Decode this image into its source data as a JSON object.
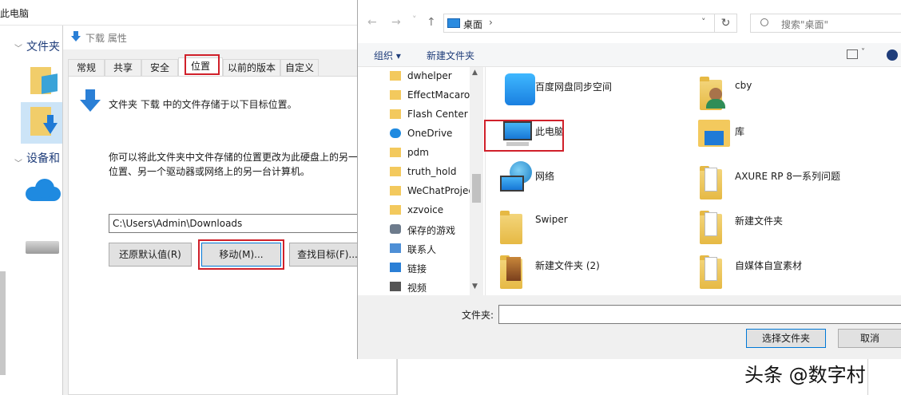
{
  "background_window": {
    "title": "此电脑",
    "nav_sections": [
      "文件夹",
      "设备和"
    ]
  },
  "properties_dialog": {
    "title": "下载 属性",
    "tabs": [
      "常规",
      "共享",
      "安全",
      "位置",
      "以前的版本",
      "自定义"
    ],
    "active_tab": "位置",
    "description": "文件夹 下载 中的文件存储于以下目标位置。",
    "info_line1": "你可以将此文件夹中文件存储的位置更改为此硬盘上的另一",
    "info_line2": "位置、另一个驱动器或网络上的另一台计算机。",
    "path_value": "C:\\Users\\Admin\\Downloads",
    "buttons": {
      "restore": "还原默认值(R)",
      "move": "移动(M)...",
      "find_target": "查找目标(F)..."
    }
  },
  "select_folder_dialog": {
    "nav": {
      "back": "←",
      "forward": "→",
      "up": "↑",
      "dropdown": "˅",
      "refresh": "↻"
    },
    "address": {
      "location": "桌面",
      "separator": "›"
    },
    "search": {
      "placeholder": "搜索\"桌面\""
    },
    "command_bar": {
      "organize": "组织 ▾",
      "new_folder": "新建文件夹"
    },
    "tree_items": [
      {
        "label": "dwhelper",
        "icon": "folder-icon"
      },
      {
        "label": "EffectMacaro",
        "icon": "folder-icon"
      },
      {
        "label": "Flash Center",
        "icon": "folder-icon"
      },
      {
        "label": "OneDrive",
        "icon": "cloud-icon"
      },
      {
        "label": "pdm",
        "icon": "folder-icon"
      },
      {
        "label": "truth_hold",
        "icon": "folder-icon"
      },
      {
        "label": "WeChatProjec",
        "icon": "folder-icon"
      },
      {
        "label": "xzvoice",
        "icon": "folder-icon"
      },
      {
        "label": "保存的游戏",
        "icon": "saved-games-icon"
      },
      {
        "label": "联系人",
        "icon": "contacts-icon"
      },
      {
        "label": "链接",
        "icon": "links-icon"
      },
      {
        "label": "视频",
        "icon": "videos-icon"
      }
    ],
    "grid_items": [
      {
        "label": "百度网盘同步空间",
        "icon": "baidu-netdisk-icon"
      },
      {
        "label": "cby",
        "icon": "user-folder-icon"
      },
      {
        "label": "此电脑",
        "icon": "this-pc-icon"
      },
      {
        "label": "库",
        "icon": "library-icon"
      },
      {
        "label": "网络",
        "icon": "network-icon"
      },
      {
        "label": "AXURE RP 8一系列问题",
        "icon": "document-folder-icon"
      },
      {
        "label": "Swiper",
        "icon": "folder-icon"
      },
      {
        "label": "新建文件夹",
        "icon": "document-folder-icon"
      },
      {
        "label": "新建文件夹 (2)",
        "icon": "image-folder-icon"
      },
      {
        "label": "自媒体自宣素材",
        "icon": "document-folder-icon"
      }
    ],
    "folder_label": "文件夹:",
    "folder_value": "",
    "buttons": {
      "select": "选择文件夹",
      "cancel": "取消"
    }
  },
  "watermark": "头条 @数字村"
}
